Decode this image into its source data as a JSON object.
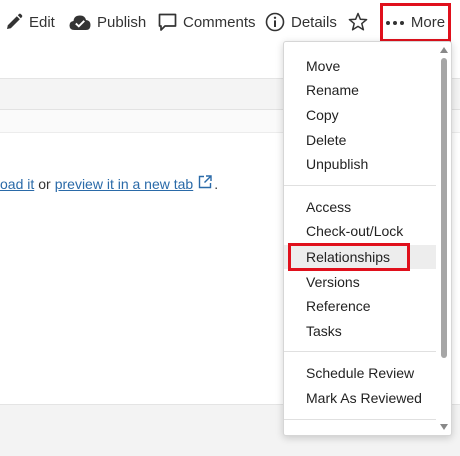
{
  "toolbar": {
    "edit_label": "Edit",
    "publish_label": "Publish",
    "comments_label": "Comments",
    "details_label": "Details",
    "more_label": "More"
  },
  "content": {
    "link_download": "oad it",
    "connector": "or",
    "link_preview": "preview it in a new tab",
    "trailing": "."
  },
  "menu": {
    "group1": [
      "Move",
      "Rename",
      "Copy",
      "Delete",
      "Unpublish"
    ],
    "group2": [
      "Access",
      "Check-out/Lock",
      "Relationships",
      "Versions",
      "Reference",
      "Tasks"
    ],
    "group3": [
      "Schedule Review",
      "Mark As Reviewed"
    ],
    "highlighted_item": "Relationships"
  },
  "colors": {
    "highlight_outline": "#e0101c",
    "link": "#2a6aa8",
    "hover_row": "#ededed"
  }
}
